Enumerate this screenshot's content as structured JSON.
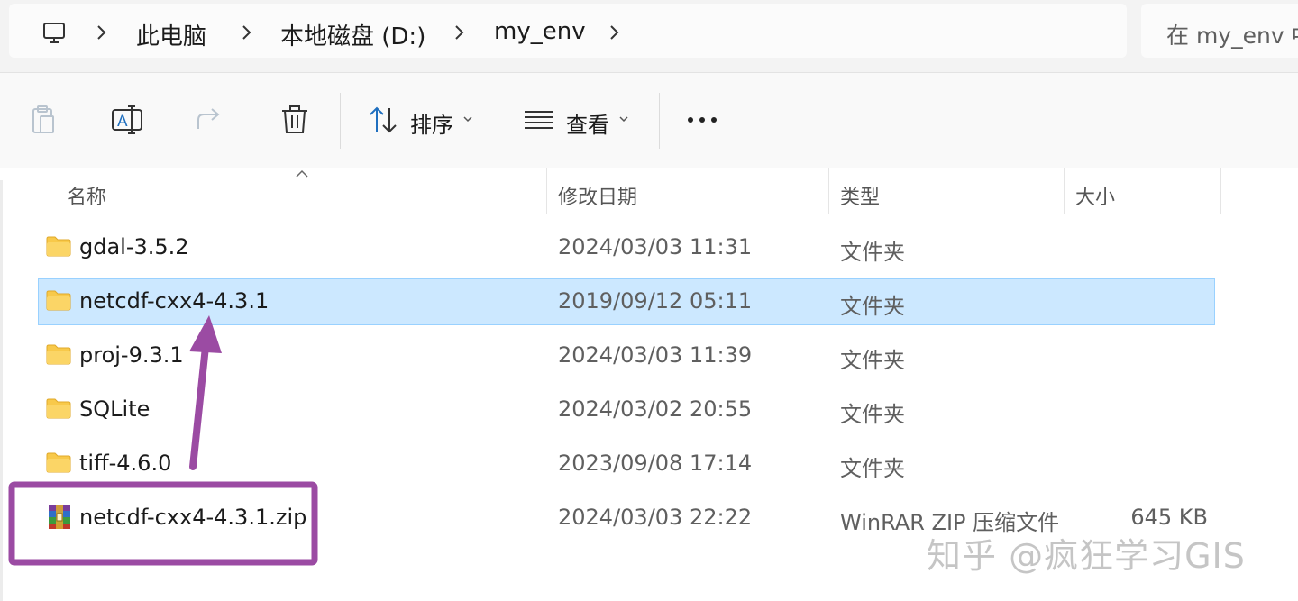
{
  "address_bar": {
    "breadcrumbs": [
      "此电脑",
      "本地磁盘 (D:)",
      "my_env"
    ],
    "search_placeholder": "在 my_env 中搜索"
  },
  "toolbar": {
    "sort_label": "排序",
    "view_label": "查看"
  },
  "columns": {
    "name": "名称",
    "modified": "修改日期",
    "type": "类型",
    "size": "大小"
  },
  "files": [
    {
      "name": "gdal-3.5.2",
      "modified": "2024/03/03 11:31",
      "type": "文件夹",
      "size": "",
      "icon": "folder-icon",
      "selected": false
    },
    {
      "name": "netcdf-cxx4-4.3.1",
      "modified": "2019/09/12 05:11",
      "type": "文件夹",
      "size": "",
      "icon": "folder-icon",
      "selected": true
    },
    {
      "name": "proj-9.3.1",
      "modified": "2024/03/03 11:39",
      "type": "文件夹",
      "size": "",
      "icon": "folder-icon",
      "selected": false
    },
    {
      "name": "SQLite",
      "modified": "2024/03/02 20:55",
      "type": "文件夹",
      "size": "",
      "icon": "folder-icon",
      "selected": false
    },
    {
      "name": "tiff-4.6.0",
      "modified": "2023/09/08 17:14",
      "type": "文件夹",
      "size": "",
      "icon": "folder-icon",
      "selected": false
    },
    {
      "name": "netcdf-cxx4-4.3.1.zip",
      "modified": "2024/03/03 22:22",
      "type": "WinRAR ZIP 压缩文件",
      "size": "645 KB",
      "icon": "winrar-archive-icon",
      "selected": false
    }
  ],
  "annotation": {
    "color": "#9b4ba3"
  },
  "watermark": "知乎 @疯狂学习GIS",
  "colors": {
    "selection": "#cce8ff",
    "selection_border": "#99d1ff",
    "folder": "#f8c94a"
  }
}
